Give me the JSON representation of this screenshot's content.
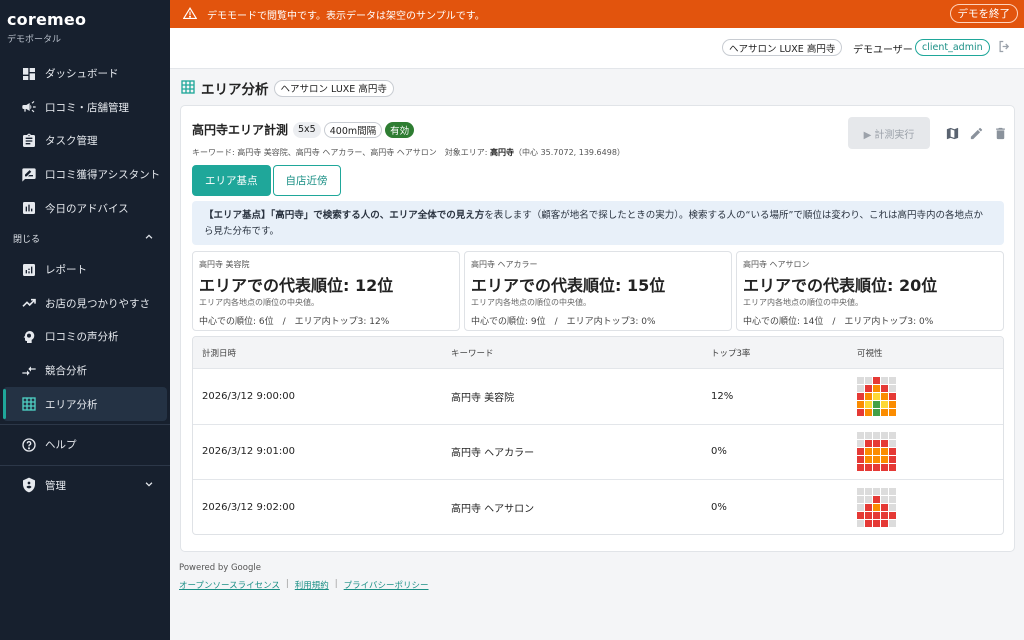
{
  "sidebar": {
    "brand": "coremeo",
    "brand_sub": "デモポータル",
    "items_top": [
      {
        "label": "ダッシュボード",
        "icon": "dashboard-icon"
      },
      {
        "label": "口コミ・店舗管理",
        "icon": "megaphone-icon"
      },
      {
        "label": "タスク管理",
        "icon": "clipboard-icon"
      },
      {
        "label": "口コミ獲得アシスタント",
        "icon": "edit-note-icon"
      },
      {
        "label": "今日のアドバイス",
        "icon": "bar-chart-icon"
      }
    ],
    "section_label": "閉じる",
    "items_sub": [
      {
        "label": "レポート",
        "icon": "report-chart-icon"
      },
      {
        "label": "お店の見つかりやすさ",
        "icon": "trending-up-icon"
      },
      {
        "label": "口コミの声分析",
        "icon": "head-icon"
      },
      {
        "label": "競合分析",
        "icon": "compare-arrows-icon"
      },
      {
        "label": "エリア分析",
        "icon": "grid-icon",
        "active": true
      }
    ],
    "help": "ヘルプ",
    "admin": "管理"
  },
  "banner": {
    "text": "デモモードで閲覧中です。表示データは架空のサンプルです。",
    "end_button": "デモを終了"
  },
  "header": {
    "salon": "ヘアサロン LUXE 高円寺",
    "user_label": "デモユーザー",
    "user_id": "client_admin"
  },
  "page": {
    "title": "エリア分析",
    "salon_tag": "ヘアサロン LUXE 高円寺"
  },
  "card": {
    "title": "高円寺エリア計測",
    "grid_tag": "5x5",
    "spacing_tag": "400m間隔",
    "status_tag": "有効",
    "meta_prefix": "キーワード: 高円寺 美容院、高円寺 ヘアカラー、高円寺 ヘアサロン　対象エリア: ",
    "meta_area": "高円寺",
    "meta_suffix": "（中心 35.7072, 139.6498）",
    "run_button": "▶ 計測実行",
    "tabs": [
      "エリア基点",
      "自店近傍"
    ],
    "info_bold1": "【エリア基点】「高円寺」で検索する人の、エリア全体での見え方",
    "info_rest": "を表します（顧客が地名で探したときの実力）。検索する人の“いる場所”で順位は変わり、これは高円寺内の各地点から見た分布です。",
    "stats": [
      {
        "label": "高円寺 美容院",
        "big": "エリアでの代表順位: 12位",
        "sub": "エリア内各地点の順位の中央値。",
        "foot": "中心での順位: 6位　/　エリア内トップ3: 12%"
      },
      {
        "label": "高円寺 ヘアカラー",
        "big": "エリアでの代表順位: 15位",
        "sub": "エリア内各地点の順位の中央値。",
        "foot": "中心での順位: 9位　/　エリア内トップ3: 0%"
      },
      {
        "label": "高円寺 ヘアサロン",
        "big": "エリアでの代表順位: 20位",
        "sub": "エリア内各地点の順位の中央値。",
        "foot": "中心での順位: 14位　/　エリア内トップ3: 0%"
      }
    ],
    "table": {
      "headers": [
        "計測日時",
        "キーワード",
        "トップ3率",
        "可視性"
      ],
      "rows": [
        {
          "date": "2026/3/12 9:00:00",
          "keyword": "高円寺 美容院",
          "top3": "12%",
          "grid": [
            "g",
            "g",
            "r",
            "g",
            "g",
            "g",
            "r",
            "o",
            "r",
            "g",
            "r",
            "o",
            "y",
            "o",
            "r",
            "o",
            "y",
            "G",
            "y",
            "o",
            "r",
            "o",
            "G",
            "o",
            "o"
          ]
        },
        {
          "date": "2026/3/12 9:01:00",
          "keyword": "高円寺 ヘアカラー",
          "top3": "0%",
          "grid": [
            "g",
            "g",
            "g",
            "g",
            "g",
            "g",
            "r",
            "r",
            "r",
            "g",
            "r",
            "o",
            "o",
            "o",
            "r",
            "r",
            "o",
            "o",
            "o",
            "r",
            "r",
            "r",
            "r",
            "r",
            "r"
          ]
        },
        {
          "date": "2026/3/12 9:02:00",
          "keyword": "高円寺 ヘアサロン",
          "top3": "0%",
          "grid": [
            "g",
            "g",
            "g",
            "g",
            "g",
            "g",
            "g",
            "r",
            "g",
            "g",
            "g",
            "r",
            "o",
            "r",
            "g",
            "r",
            "r",
            "r",
            "r",
            "r",
            "g",
            "r",
            "r",
            "r",
            "g"
          ]
        }
      ]
    },
    "grid_colors": {
      "g": "#dcdcdc",
      "r": "#e53935",
      "o": "#fb8c00",
      "y": "#fdd835",
      "G": "#43a047"
    }
  },
  "footer": {
    "powered": "Powered by Google",
    "links": [
      "オープンソースライセンス",
      "利用規約",
      "プライバシーポリシー"
    ]
  }
}
